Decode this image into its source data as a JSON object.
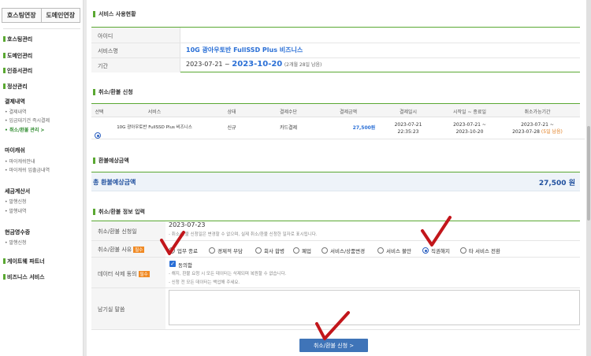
{
  "sidebar": {
    "tabs": [
      "호스팅연장",
      "도메인연장"
    ],
    "menu": [
      {
        "label": "호스팅관리"
      },
      {
        "label": "도메인관리"
      },
      {
        "label": "인증서관리"
      },
      {
        "label": "정산관리"
      }
    ],
    "payment_header": "결제내역",
    "payment_items": [
      "결제내역",
      "입금대기건 즉시결제",
      "취소/환불 관리 >"
    ],
    "mycash_header": "마이캐쉬",
    "mycash_items": [
      "마이캐쉬안내",
      "마이캐쉬 입출금내역"
    ],
    "tax_header": "세금계산서",
    "tax_items": [
      "발행신청",
      "발행내역"
    ],
    "cash_header": "현금영수증",
    "cash_items": [
      "발행신청"
    ],
    "partner": "게이트웨 파트너",
    "business": "비즈니스 서비스"
  },
  "service_status": {
    "title": "서비스 사용현황",
    "id_label": "아이디",
    "id_value": "",
    "service_label": "서비스명",
    "service_value": "10G 광아우토반 FullSSD Plus 비즈니스",
    "period_label": "기간",
    "period_start": "2023-07-21 ~",
    "period_end": "2023-10-20",
    "remaining": "(2개월 28일 남음)"
  },
  "refund_request": {
    "title": "취소/환불 신청",
    "headers": [
      "선택",
      "서비스",
      "상태",
      "결제수단",
      "결제금액",
      "결제일시",
      "시작일 ~ 종료일",
      "취소가능기간"
    ],
    "row": {
      "service": "10G 광아우토반 FullSSD Plus 비즈니스",
      "status": "신규",
      "method": "카드결제",
      "amount": "27,500원",
      "paid_date": "2023-07-21",
      "paid_time": "22:35:23",
      "start": "2023-07-21 ~",
      "end": "2023-10-20",
      "cancel_from": "2023-07-21 ~",
      "cancel_to": "2023-07-28",
      "cancel_left": "(5일 남음)"
    }
  },
  "refund_estimate": {
    "title": "환불예상금액",
    "total_label": "총 환불예상금액",
    "total_value": "27,500 원"
  },
  "refund_info": {
    "title": "취소/환불 정보 입력",
    "date_label": "취소/환불 신청일",
    "date_value": "2023-07-23",
    "date_note": "- 취소/환불 신청일은 변경할 수 없으며, 실제 취소/환불 신청한 일자로 표시됩니다.",
    "reason_label": "취소/환불 사유",
    "required": "필수",
    "reasons": [
      "업무 종료",
      "경제적 부담",
      "회사 합병",
      "폐업",
      "서비스/상품변경",
      "서비스 불만",
      "직권해지",
      "타 서비스 전환"
    ],
    "selected_reason": "직권해지",
    "delete_label": "데이터 삭제 동의",
    "agree_label": "동의함",
    "delete_note1": "- 해지, 환불 요청 시 모든 데이터는 삭제되며 복원할 수 없습니다.",
    "delete_note2": "- 신청 전 모든 데이터는 백업해 주세요.",
    "memo_label": "남기실 말씀",
    "memo_value": ""
  },
  "submit_label": "취소/환불 신청 >",
  "colors": {
    "accent": "#5aa832",
    "link": "#2a6fd6",
    "button": "#3f74b8",
    "check_mark": "#c2161b"
  }
}
